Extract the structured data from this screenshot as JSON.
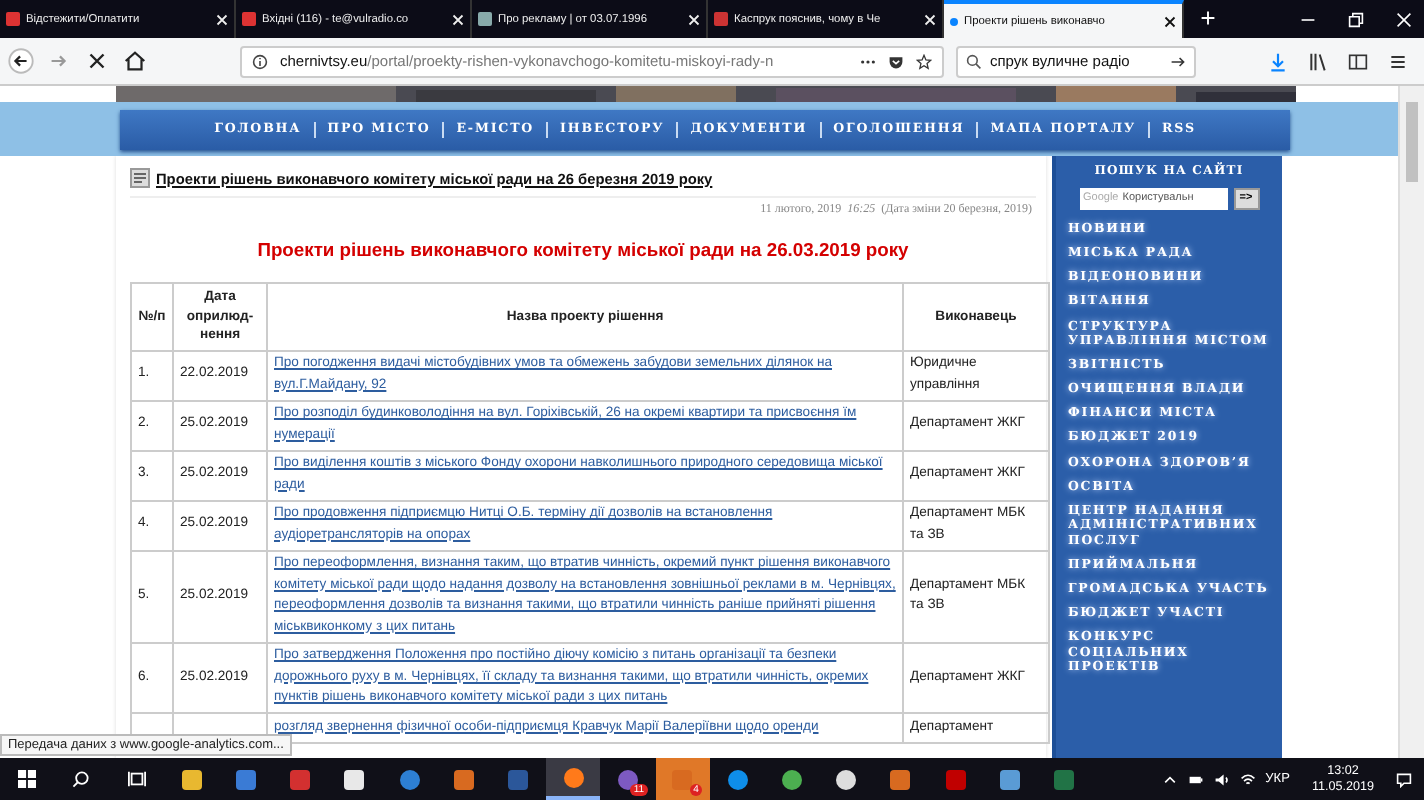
{
  "browser": {
    "tabs": [
      {
        "title": "Відстежити/Оплатити",
        "selected": false
      },
      {
        "title": "Вхідні (116) - te@vulradio.co",
        "selected": false
      },
      {
        "title": "Про рекламу | от 03.07.1996",
        "selected": false
      },
      {
        "title": "Каспрук пояснив, чому в Че",
        "selected": false
      },
      {
        "title": "Проекти рішень виконавчо",
        "selected": true
      }
    ],
    "address": {
      "host": "chernivtsy.eu",
      "path": "/portal/proekty-rishen-vykonavchogo-komitetu-miskoyi-rady-n",
      "loading": true
    },
    "search": {
      "value": "спрук вуличне радіо"
    }
  },
  "site_nav": {
    "items": [
      "ГОЛОВНА",
      "ПРО МІСТО",
      "Е-МІСТО",
      "ІНВЕСТОРУ",
      "ДОКУМЕНТИ",
      "ОГОЛОШЕННЯ",
      "МАПА ПОРТАЛУ",
      "RSS"
    ]
  },
  "article": {
    "title": "Проекти рішень виконавчого комітету міської ради на 26 березня 2019 року",
    "date": "11 лютого, 2019",
    "time": "16:25",
    "modified": "(Дата зміни 20 березня, 2019)",
    "heading": "Проекти рішень виконавчого комітету міської ради на 26.03.2019 року",
    "table": {
      "columns": [
        "№/п",
        "Дата оприлюд-нення",
        "Назва проекту рішення",
        "Виконавець"
      ],
      "rows": [
        {
          "num": "1.",
          "date": "22.02.2019",
          "name": "Про погодження видачі містобудівних умов та обмежень забудови земельних ділянок на вул.Г.Майдану, 92",
          "executor": "Юридичне управління"
        },
        {
          "num": "2.",
          "date": "25.02.2019",
          "name": "Про розподіл будинковолодіння на вул. Горіхівській, 26 на окремі квартири та присвоєння їм нумерації",
          "executor": "Департамент ЖКГ"
        },
        {
          "num": "3.",
          "date": "25.02.2019",
          "name": "Про виділення коштів з міського Фонду охорони навколишнього природного середовища міської ради",
          "executor": "Департамент ЖКГ"
        },
        {
          "num": "4.",
          "date": "25.02.2019",
          "name": "Про продовження підприємцю Нитці О.Б. терміну дії дозволів на встановлення аудіоретрансляторів на опорах",
          "executor": "Департамент МБК та ЗВ"
        },
        {
          "num": "5.",
          "date": "25.02.2019",
          "name": "Про переоформлення, визнання таким, що втратив чинність, окремий пункт рішення виконавчого комітету міської ради щодо надання дозволу на встановлення зовнішньої реклами в м. Чернівцях, переоформлення дозволів та визнання такими, що втратили чинність раніше прийняті рішення міськвиконкому з цих питань",
          "executor": "Департамент МБК та ЗВ"
        },
        {
          "num": "6.",
          "date": "25.02.2019",
          "name": "Про затвердження Положення про постійно діючу комісію з питань організації та безпеки дорожнього руху в м. Чернівцях, її складу та визнання такими, що втратили чинність, окремих пунктів рішень виконавчого комітету міської ради з цих питань",
          "executor": "Департамент ЖКГ"
        },
        {
          "name": "розгляд звернення фізичної особи-підприємця Кравчук Марії Валеріївни щодо оренди",
          "executor": "Департамент"
        }
      ]
    }
  },
  "sidebar": {
    "search_title": "ПОШУК НА САЙТІ",
    "search_brand": "Google",
    "search_placeholder": "Користувальн",
    "search_button": "=>",
    "items": [
      "НОВИНИ",
      "МІСЬКА РАДА",
      "ВІДЕОНОВИНИ",
      "ВІТАННЯ",
      "СТРУКТУРА УПРАВЛІННЯ МІСТОМ",
      "ЗВІТНІСТЬ",
      "ОЧИЩЕННЯ ВЛАДИ",
      "ФІНАНСИ МІСТА",
      "БЮДЖЕТ 2019",
      "ОХОРОНА ЗДОРОВ’Я",
      "ОСВІТА",
      "ЦЕНТР НАДАННЯ АДМІНІСТРАТИВНИХ ПОСЛУГ",
      "ПРИЙМАЛЬНЯ",
      "ГРОМАДСЬКА УЧАСТЬ",
      "БЮДЖЕТ УЧАСТІ",
      "КОНКУРС СОЦІАЛЬНИХ ПРОЕКТІВ"
    ]
  },
  "status_tooltip": "Передача даних з www.google-analytics.com...",
  "taskbar": {
    "apps": [
      {
        "kind": "start"
      },
      {
        "kind": "search"
      },
      {
        "kind": "taskview"
      },
      {
        "kind": "folder"
      },
      {
        "kind": "store"
      },
      {
        "kind": "gift"
      },
      {
        "kind": "mail"
      },
      {
        "kind": "edge"
      },
      {
        "kind": "app"
      },
      {
        "kind": "word"
      },
      {
        "kind": "firefox",
        "selected": true
      },
      {
        "kind": "viber",
        "badge": "11"
      },
      {
        "kind": "app",
        "flashing": true,
        "badge": "4"
      },
      {
        "kind": "teamviewer"
      },
      {
        "kind": "chrome"
      },
      {
        "kind": "circle"
      },
      {
        "kind": "app"
      },
      {
        "kind": "acrobat"
      },
      {
        "kind": "photos"
      },
      {
        "kind": "excel"
      }
    ],
    "tray": {
      "language": "УКР",
      "time": "13:02",
      "date": "11.05.2019"
    }
  }
}
